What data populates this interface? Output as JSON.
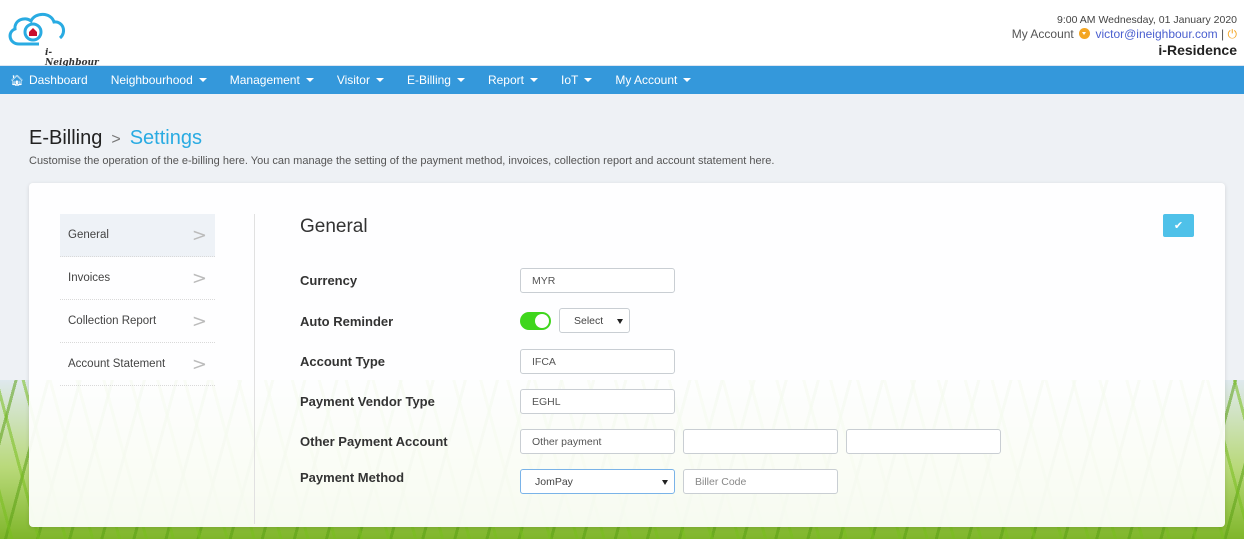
{
  "header": {
    "logo_text": "i-Neighbour",
    "datetime": "9:00 AM Wednesday, 01 January 2020",
    "account_label": "My Account",
    "account_email": "victor@ineighbour.com",
    "separator": "|",
    "org_name": "i-Residence"
  },
  "nav": {
    "items": [
      {
        "label": "Dashboard",
        "icon": "home-icon",
        "dropdown": false
      },
      {
        "label": "Neighbourhood",
        "dropdown": true
      },
      {
        "label": "Management",
        "dropdown": true
      },
      {
        "label": "Visitor",
        "dropdown": true
      },
      {
        "label": "E-Billing",
        "dropdown": true
      },
      {
        "label": "Report",
        "dropdown": true
      },
      {
        "label": "IoT",
        "dropdown": true
      },
      {
        "label": "My Account",
        "dropdown": true
      }
    ]
  },
  "page": {
    "breadcrumb_parent": "E-Billing",
    "breadcrumb_separator": ">",
    "breadcrumb_current": "Settings",
    "subtitle": "Customise the operation of the e-billing here. You can manage the setting of the payment method, invoices, collection report and account statement here."
  },
  "side_menu": {
    "items": [
      {
        "label": "General",
        "active": true
      },
      {
        "label": "Invoices",
        "active": false
      },
      {
        "label": "Collection Report",
        "active": false
      },
      {
        "label": "Account Statement",
        "active": false
      }
    ],
    "chevron": ">"
  },
  "settings": {
    "section_title": "General",
    "save_icon": "✔",
    "fields": {
      "currency": {
        "label": "Currency",
        "value": "MYR"
      },
      "auto_reminder": {
        "label": "Auto Reminder",
        "enabled": true,
        "select_value": "Select"
      },
      "account_type": {
        "label": "Account Type",
        "value": "IFCA"
      },
      "payment_vendor_type": {
        "label": "Payment Vendor Type",
        "value": "EGHL"
      },
      "other_payment_account": {
        "label": "Other Payment Account",
        "values": [
          "Other payment",
          "",
          ""
        ]
      },
      "payment_method": {
        "label": "Payment Method",
        "select_value": "JomPay",
        "biller_code_placeholder": "Biller Code"
      }
    }
  },
  "colors": {
    "nav_bg": "#3498db",
    "accent": "#29abe2",
    "toggle_on": "#3fd61c",
    "save_button": "#4fc1e9",
    "account_icon": "#f4a623"
  }
}
